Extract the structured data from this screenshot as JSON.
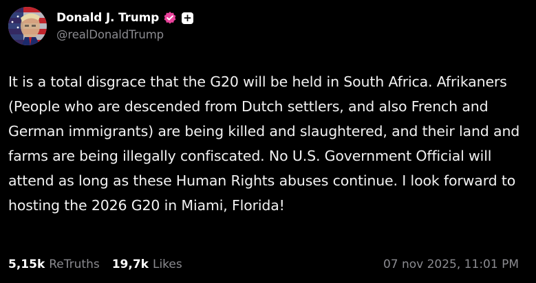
{
  "author": {
    "display_name": "Donald J. Trump",
    "handle": "@realDonaldTrump",
    "verified_badge_icon": "verified-badge-icon",
    "verified_color": "#e9429b",
    "extra_badge_icon": "plus-icon",
    "avatar_icon": "avatar-photo"
  },
  "post": {
    "text": "It is a total disgrace that the G20 will be held in South Africa. Afrikaners (People who are descended from Dutch settlers, and also French and German immigrants) are being killed and slaughtered, and their land and farms are being illegally confiscated. No U.S. Government Official will attend as long as these Human Rights abuses continue. I look forward to hosting the 2026 G20 in Miami, Florida!"
  },
  "footer": {
    "retruths_count": "5,15k",
    "retruths_label": "ReTruths",
    "likes_count": "19,7k",
    "likes_label": "Likes",
    "timestamp": "07 nov 2025, 11:01 PM"
  },
  "colors": {
    "background": "#000000",
    "text": "#ffffff",
    "muted": "#8b8b90"
  }
}
